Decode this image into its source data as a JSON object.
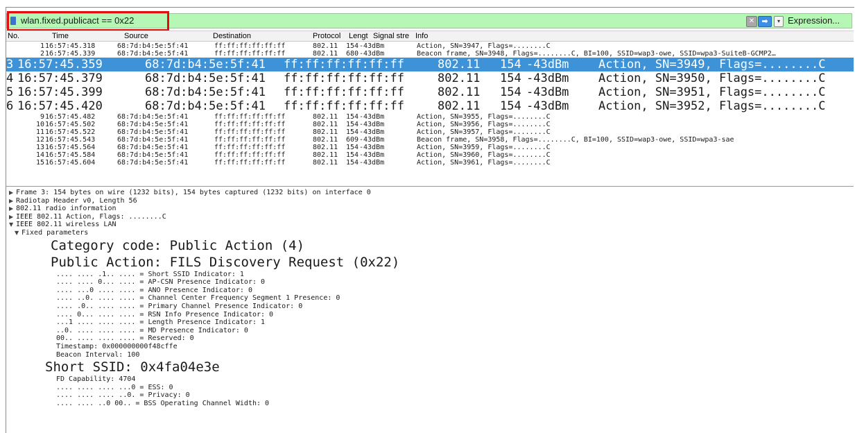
{
  "filter": {
    "value": "wlan.fixed.publicact == 0x22",
    "clear_glyph": "✕",
    "apply_glyph": "➡",
    "dropdown_glyph": "▾",
    "expression_label": "Expression..."
  },
  "columns": [
    "No.",
    "Time",
    "Source",
    "Destination",
    "Protocol",
    "Lengt",
    "Signal stre",
    "Info"
  ],
  "packets": [
    {
      "no": "1",
      "time": "16:57:45.318",
      "src": "68:7d:b4:5e:5f:41",
      "dst": "ff:ff:ff:ff:ff:ff",
      "proto": "802.11",
      "len": "154",
      "sig": "-43dBm",
      "info": "Action, SN=3947, Flags=........C",
      "size": "small"
    },
    {
      "no": "2",
      "time": "16:57:45.339",
      "src": "68:7d:b4:5e:5f:41",
      "dst": "ff:ff:ff:ff:ff:ff",
      "proto": "802.11",
      "len": "680",
      "sig": "-43dBm",
      "info": "Beacon frame, SN=3948, Flags=........C, BI=100, SSID=wap3-owe, SSID=wpa3-SuiteB-GCMP2…",
      "size": "small"
    },
    {
      "no": "3",
      "time": "16:57:45.359",
      "src": "68:7d:b4:5e:5f:41",
      "dst": "ff:ff:ff:ff:ff:ff",
      "proto": "802.11",
      "len": "154",
      "sig": "-43dBm",
      "info": "Action, SN=3949, Flags=........C",
      "size": "big",
      "selected": true
    },
    {
      "no": "4",
      "time": "16:57:45.379",
      "src": "68:7d:b4:5e:5f:41",
      "dst": "ff:ff:ff:ff:ff:ff",
      "proto": "802.11",
      "len": "154",
      "sig": "-43dBm",
      "info": "Action, SN=3950, Flags=........C",
      "size": "big"
    },
    {
      "no": "5",
      "time": "16:57:45.399",
      "src": "68:7d:b4:5e:5f:41",
      "dst": "ff:ff:ff:ff:ff:ff",
      "proto": "802.11",
      "len": "154",
      "sig": "-43dBm",
      "info": "Action, SN=3951, Flags=........C",
      "size": "big"
    },
    {
      "no": "6",
      "time": "16:57:45.420",
      "src": "68:7d:b4:5e:5f:41",
      "dst": "ff:ff:ff:ff:ff:ff",
      "proto": "802.11",
      "len": "154",
      "sig": "-43dBm",
      "info": "Action, SN=3952, Flags=........C",
      "size": "big"
    },
    {
      "no": "9",
      "time": "16:57:45.482",
      "src": "68:7d:b4:5e:5f:41",
      "dst": "ff:ff:ff:ff:ff:ff",
      "proto": "802.11",
      "len": "154",
      "sig": "-43dBm",
      "info": "Action, SN=3955, Flags=........C",
      "size": "small"
    },
    {
      "no": "10",
      "time": "16:57:45.502",
      "src": "68:7d:b4:5e:5f:41",
      "dst": "ff:ff:ff:ff:ff:ff",
      "proto": "802.11",
      "len": "154",
      "sig": "-43dBm",
      "info": "Action, SN=3956, Flags=........C",
      "size": "small"
    },
    {
      "no": "11",
      "time": "16:57:45.522",
      "src": "68:7d:b4:5e:5f:41",
      "dst": "ff:ff:ff:ff:ff:ff",
      "proto": "802.11",
      "len": "154",
      "sig": "-43dBm",
      "info": "Action, SN=3957, Flags=........C",
      "size": "small"
    },
    {
      "no": "12",
      "time": "16:57:45.543",
      "src": "68:7d:b4:5e:5f:41",
      "dst": "ff:ff:ff:ff:ff:ff",
      "proto": "802.11",
      "len": "609",
      "sig": "-43dBm",
      "info": "Beacon frame, SN=3958, Flags=........C, BI=100, SSID=wap3-owe, SSID=wpa3-sae",
      "size": "small"
    },
    {
      "no": "13",
      "time": "16:57:45.564",
      "src": "68:7d:b4:5e:5f:41",
      "dst": "ff:ff:ff:ff:ff:ff",
      "proto": "802.11",
      "len": "154",
      "sig": "-43dBm",
      "info": "Action, SN=3959, Flags=........C",
      "size": "small"
    },
    {
      "no": "14",
      "time": "16:57:45.584",
      "src": "68:7d:b4:5e:5f:41",
      "dst": "ff:ff:ff:ff:ff:ff",
      "proto": "802.11",
      "len": "154",
      "sig": "-43dBm",
      "info": "Action, SN=3960, Flags=........C",
      "size": "small"
    },
    {
      "no": "15",
      "time": "16:57:45.604",
      "src": "68:7d:b4:5e:5f:41",
      "dst": "ff:ff:ff:ff:ff:ff",
      "proto": "802.11",
      "len": "154",
      "sig": "-43dBm",
      "info": "Action, SN=3961, Flags=........C",
      "size": "small"
    }
  ],
  "details": [
    {
      "text": "Frame 3: 154 bytes on wire (1232 bits), 154 bytes captured (1232 bits) on interface 0",
      "size": "s",
      "indent": 0,
      "toggle": "collapsed"
    },
    {
      "text": "Radiotap Header v0, Length 56",
      "size": "s",
      "indent": 0,
      "toggle": "collapsed"
    },
    {
      "text": "802.11 radio information",
      "size": "s",
      "indent": 0,
      "toggle": "collapsed"
    },
    {
      "text": "IEEE 802.11 Action, Flags: ........C",
      "size": "s",
      "indent": 0,
      "toggle": "collapsed"
    },
    {
      "text": "IEEE 802.11 wireless LAN",
      "size": "s",
      "indent": 0,
      "toggle": "expanded"
    },
    {
      "text": "Fixed parameters",
      "size": "s",
      "indent": 1,
      "toggle": "expanded"
    },
    {
      "text": "Category code: Public Action (4)",
      "size": "l",
      "indent": 2
    },
    {
      "text": "Public Action: FILS Discovery Request (0x22)",
      "size": "l",
      "indent": 2
    },
    {
      "text": ".... .... .1.. .... = Short SSID Indicator: 1",
      "size": "s",
      "indent": 2
    },
    {
      "text": ".... .... 0... .... = AP-CSN Presence Indicator: 0",
      "size": "s",
      "indent": 2
    },
    {
      "text": ".... ...0 .... .... = ANO Presence Indicator: 0",
      "size": "s",
      "indent": 2
    },
    {
      "text": ".... ..0. .... .... = Channel Center Frequency Segment 1 Presence: 0",
      "size": "s",
      "indent": 2
    },
    {
      "text": ".... .0.. .... .... = Primary Channel Presence Indicator: 0",
      "size": "s",
      "indent": 2
    },
    {
      "text": ".... 0... .... .... = RSN Info Presence Indicator: 0",
      "size": "s",
      "indent": 2
    },
    {
      "text": "...1 .... .... .... = Length Presence Indicator: 1",
      "size": "s",
      "indent": 2
    },
    {
      "text": "..0. .... .... .... = MD Presence Indicator: 0",
      "size": "s",
      "indent": 2
    },
    {
      "text": "00.. .... .... .... = Reserved: 0",
      "size": "s",
      "indent": 2
    },
    {
      "text": "Timestamp: 0x000000000f48cffe",
      "size": "s",
      "indent": 2
    },
    {
      "text": "Beacon Interval: 100",
      "size": "s",
      "indent": 2
    },
    {
      "text": "Short SSID: 0x4fa04e3e",
      "size": "l",
      "indent": 1
    },
    {
      "text": "FD Capability: 4704",
      "size": "s",
      "indent": 2
    },
    {
      "text": ".... .... .... ...0 = ESS: 0",
      "size": "s",
      "indent": 2
    },
    {
      "text": ".... .... .... ..0. = Privacy: 0",
      "size": "s",
      "indent": 2
    },
    {
      "text": ".... .... ..0 00.. = BSS Operating Channel Width: 0",
      "size": "s",
      "indent": 2
    }
  ],
  "colors": {
    "filter_bg": "#b6f7b6",
    "selected_row": "#3e92d8",
    "highlight_box": "#e01010"
  }
}
